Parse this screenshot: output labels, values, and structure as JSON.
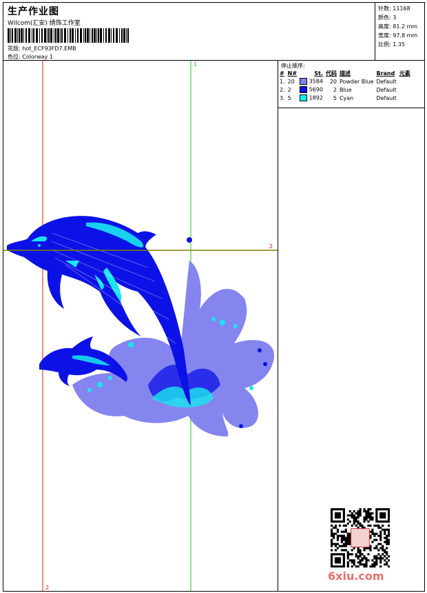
{
  "header": {
    "title": "生产作业图",
    "subtitle": "Wilcom(汇安) 绣饰工作室",
    "design_label": "花版:",
    "design_value": "hot_ECF93FD7.EMB",
    "colorway_label": "色位:",
    "colorway_value": "Colorway 1"
  },
  "stats": {
    "stitches": "针数: 11168",
    "colors": "颜色: 3",
    "height": "高度: 81.2 mm",
    "width": "宽度: 97.8 mm",
    "scale": "比例: 1.35"
  },
  "stop_sequence": {
    "title": "停止顺序:",
    "headers": [
      "#",
      "N#",
      "St.",
      "代码",
      "描述",
      "Brand",
      "元素"
    ],
    "rows": [
      {
        "idx": "1.",
        "n": "20",
        "color": "#8080f0",
        "st": "3584",
        "code": "20",
        "desc": "Powder Blue",
        "brand": "Default"
      },
      {
        "idx": "2.",
        "n": "2",
        "color": "#0a10e8",
        "st": "5690",
        "code": "2",
        "desc": "Blue",
        "brand": "Default"
      },
      {
        "idx": "3.",
        "n": "5",
        "color": "#10f0f0",
        "st": "1892",
        "code": "5",
        "desc": "Cyan",
        "brand": "Default"
      }
    ]
  },
  "guides": {
    "top_label": "1",
    "right_label": "2",
    "bottom_label": "2"
  },
  "watermark": "6xiu.com",
  "colors": {
    "guide_red": "#e01010",
    "guide_green": "#10d010",
    "guide_olive": "#808000"
  }
}
